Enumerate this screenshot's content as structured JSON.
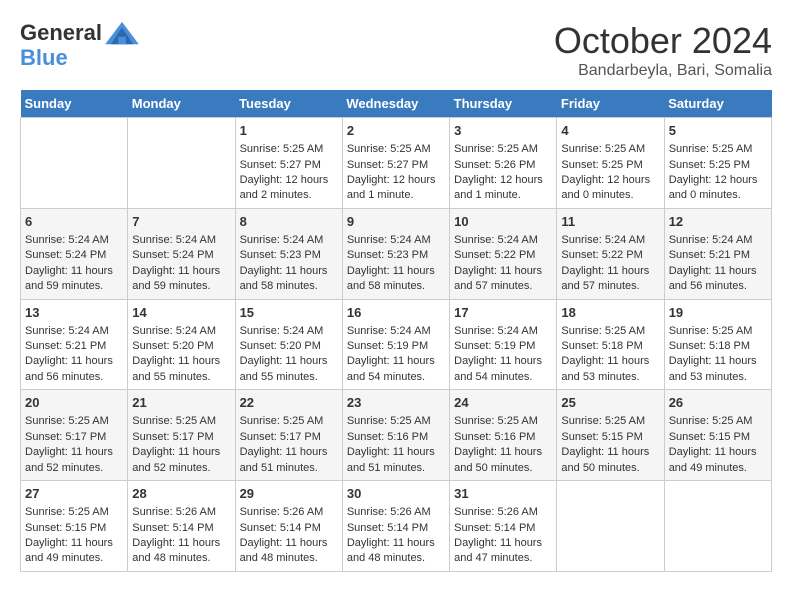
{
  "header": {
    "logo_line1": "General",
    "logo_line2": "Blue",
    "month_title": "October 2024",
    "location": "Bandarbeyla, Bari, Somalia"
  },
  "days_of_week": [
    "Sunday",
    "Monday",
    "Tuesday",
    "Wednesday",
    "Thursday",
    "Friday",
    "Saturday"
  ],
  "weeks": [
    [
      {
        "day": "",
        "empty": true
      },
      {
        "day": "",
        "empty": true
      },
      {
        "day": "1",
        "sunrise": "Sunrise: 5:25 AM",
        "sunset": "Sunset: 5:27 PM",
        "daylight": "Daylight: 12 hours and 2 minutes."
      },
      {
        "day": "2",
        "sunrise": "Sunrise: 5:25 AM",
        "sunset": "Sunset: 5:27 PM",
        "daylight": "Daylight: 12 hours and 1 minute."
      },
      {
        "day": "3",
        "sunrise": "Sunrise: 5:25 AM",
        "sunset": "Sunset: 5:26 PM",
        "daylight": "Daylight: 12 hours and 1 minute."
      },
      {
        "day": "4",
        "sunrise": "Sunrise: 5:25 AM",
        "sunset": "Sunset: 5:25 PM",
        "daylight": "Daylight: 12 hours and 0 minutes."
      },
      {
        "day": "5",
        "sunrise": "Sunrise: 5:25 AM",
        "sunset": "Sunset: 5:25 PM",
        "daylight": "Daylight: 12 hours and 0 minutes."
      }
    ],
    [
      {
        "day": "6",
        "sunrise": "Sunrise: 5:24 AM",
        "sunset": "Sunset: 5:24 PM",
        "daylight": "Daylight: 11 hours and 59 minutes."
      },
      {
        "day": "7",
        "sunrise": "Sunrise: 5:24 AM",
        "sunset": "Sunset: 5:24 PM",
        "daylight": "Daylight: 11 hours and 59 minutes."
      },
      {
        "day": "8",
        "sunrise": "Sunrise: 5:24 AM",
        "sunset": "Sunset: 5:23 PM",
        "daylight": "Daylight: 11 hours and 58 minutes."
      },
      {
        "day": "9",
        "sunrise": "Sunrise: 5:24 AM",
        "sunset": "Sunset: 5:23 PM",
        "daylight": "Daylight: 11 hours and 58 minutes."
      },
      {
        "day": "10",
        "sunrise": "Sunrise: 5:24 AM",
        "sunset": "Sunset: 5:22 PM",
        "daylight": "Daylight: 11 hours and 57 minutes."
      },
      {
        "day": "11",
        "sunrise": "Sunrise: 5:24 AM",
        "sunset": "Sunset: 5:22 PM",
        "daylight": "Daylight: 11 hours and 57 minutes."
      },
      {
        "day": "12",
        "sunrise": "Sunrise: 5:24 AM",
        "sunset": "Sunset: 5:21 PM",
        "daylight": "Daylight: 11 hours and 56 minutes."
      }
    ],
    [
      {
        "day": "13",
        "sunrise": "Sunrise: 5:24 AM",
        "sunset": "Sunset: 5:21 PM",
        "daylight": "Daylight: 11 hours and 56 minutes."
      },
      {
        "day": "14",
        "sunrise": "Sunrise: 5:24 AM",
        "sunset": "Sunset: 5:20 PM",
        "daylight": "Daylight: 11 hours and 55 minutes."
      },
      {
        "day": "15",
        "sunrise": "Sunrise: 5:24 AM",
        "sunset": "Sunset: 5:20 PM",
        "daylight": "Daylight: 11 hours and 55 minutes."
      },
      {
        "day": "16",
        "sunrise": "Sunrise: 5:24 AM",
        "sunset": "Sunset: 5:19 PM",
        "daylight": "Daylight: 11 hours and 54 minutes."
      },
      {
        "day": "17",
        "sunrise": "Sunrise: 5:24 AM",
        "sunset": "Sunset: 5:19 PM",
        "daylight": "Daylight: 11 hours and 54 minutes."
      },
      {
        "day": "18",
        "sunrise": "Sunrise: 5:25 AM",
        "sunset": "Sunset: 5:18 PM",
        "daylight": "Daylight: 11 hours and 53 minutes."
      },
      {
        "day": "19",
        "sunrise": "Sunrise: 5:25 AM",
        "sunset": "Sunset: 5:18 PM",
        "daylight": "Daylight: 11 hours and 53 minutes."
      }
    ],
    [
      {
        "day": "20",
        "sunrise": "Sunrise: 5:25 AM",
        "sunset": "Sunset: 5:17 PM",
        "daylight": "Daylight: 11 hours and 52 minutes."
      },
      {
        "day": "21",
        "sunrise": "Sunrise: 5:25 AM",
        "sunset": "Sunset: 5:17 PM",
        "daylight": "Daylight: 11 hours and 52 minutes."
      },
      {
        "day": "22",
        "sunrise": "Sunrise: 5:25 AM",
        "sunset": "Sunset: 5:17 PM",
        "daylight": "Daylight: 11 hours and 51 minutes."
      },
      {
        "day": "23",
        "sunrise": "Sunrise: 5:25 AM",
        "sunset": "Sunset: 5:16 PM",
        "daylight": "Daylight: 11 hours and 51 minutes."
      },
      {
        "day": "24",
        "sunrise": "Sunrise: 5:25 AM",
        "sunset": "Sunset: 5:16 PM",
        "daylight": "Daylight: 11 hours and 50 minutes."
      },
      {
        "day": "25",
        "sunrise": "Sunrise: 5:25 AM",
        "sunset": "Sunset: 5:15 PM",
        "daylight": "Daylight: 11 hours and 50 minutes."
      },
      {
        "day": "26",
        "sunrise": "Sunrise: 5:25 AM",
        "sunset": "Sunset: 5:15 PM",
        "daylight": "Daylight: 11 hours and 49 minutes."
      }
    ],
    [
      {
        "day": "27",
        "sunrise": "Sunrise: 5:25 AM",
        "sunset": "Sunset: 5:15 PM",
        "daylight": "Daylight: 11 hours and 49 minutes."
      },
      {
        "day": "28",
        "sunrise": "Sunrise: 5:26 AM",
        "sunset": "Sunset: 5:14 PM",
        "daylight": "Daylight: 11 hours and 48 minutes."
      },
      {
        "day": "29",
        "sunrise": "Sunrise: 5:26 AM",
        "sunset": "Sunset: 5:14 PM",
        "daylight": "Daylight: 11 hours and 48 minutes."
      },
      {
        "day": "30",
        "sunrise": "Sunrise: 5:26 AM",
        "sunset": "Sunset: 5:14 PM",
        "daylight": "Daylight: 11 hours and 48 minutes."
      },
      {
        "day": "31",
        "sunrise": "Sunrise: 5:26 AM",
        "sunset": "Sunset: 5:14 PM",
        "daylight": "Daylight: 11 hours and 47 minutes."
      },
      {
        "day": "",
        "empty": true
      },
      {
        "day": "",
        "empty": true
      }
    ]
  ]
}
